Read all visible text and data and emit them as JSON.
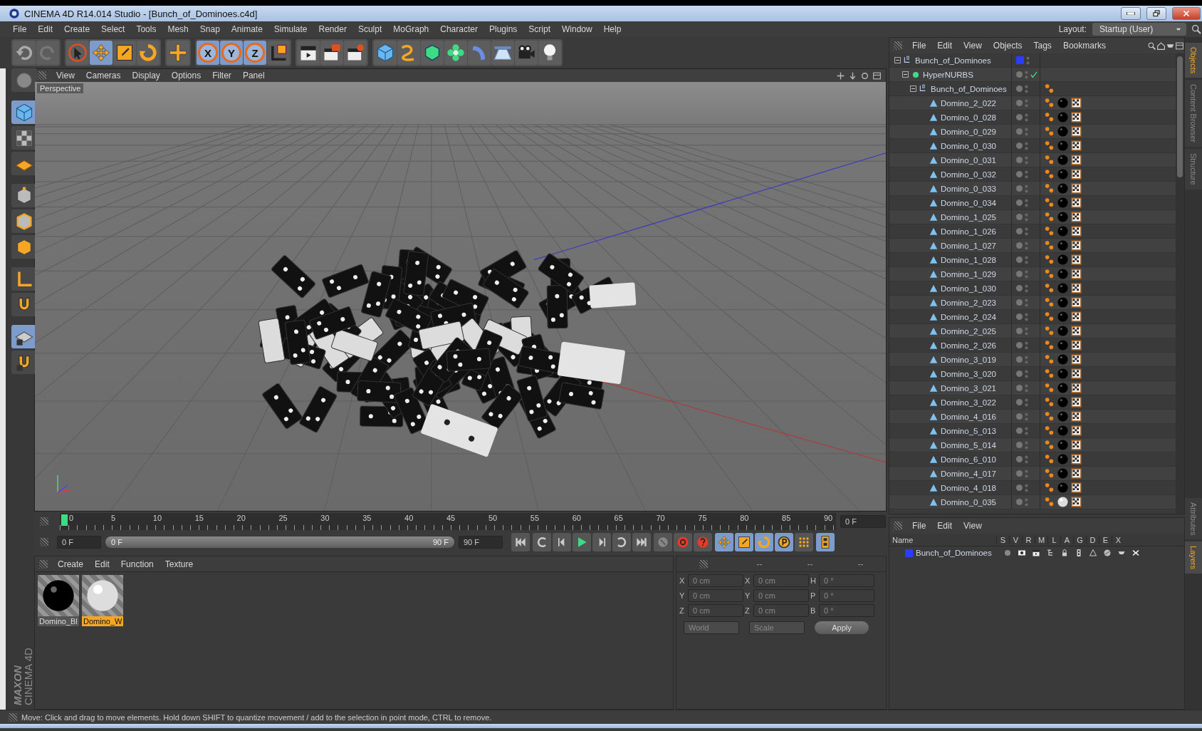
{
  "window": {
    "title": "CINEMA 4D R14.014 Studio - [Bunch_of_Dominoes.c4d]"
  },
  "menu": [
    "File",
    "Edit",
    "Create",
    "Select",
    "Tools",
    "Mesh",
    "Snap",
    "Animate",
    "Simulate",
    "Render",
    "Sculpt",
    "MoGraph",
    "Character",
    "Plugins",
    "Script",
    "Window",
    "Help"
  ],
  "layout": {
    "label": "Layout:",
    "value": "Startup (User)"
  },
  "toolbar": [
    [
      {
        "kind": "undo",
        "selected": false
      },
      {
        "kind": "redo",
        "selected": false
      }
    ],
    [
      {
        "kind": "cursor",
        "selected": false
      },
      {
        "kind": "move",
        "selected": true
      },
      {
        "kind": "scale",
        "selected": false
      },
      {
        "kind": "rotate",
        "selected": false
      }
    ],
    [
      {
        "kind": "cross",
        "selected": false
      }
    ],
    [
      {
        "kind": "axis",
        "label": "X",
        "selected": true
      },
      {
        "kind": "axis",
        "label": "Y",
        "selected": true
      },
      {
        "kind": "axis",
        "label": "Z",
        "selected": true
      },
      {
        "kind": "coord",
        "selected": false
      }
    ],
    [
      {
        "kind": "clapper",
        "selected": false
      },
      {
        "kind": "clapper-view",
        "selected": false
      },
      {
        "kind": "clapper-gear",
        "selected": false
      }
    ],
    [
      {
        "kind": "cube",
        "selected": false
      },
      {
        "kind": "spline",
        "selected": false
      },
      {
        "kind": "nurbs-cube",
        "selected": false
      },
      {
        "kind": "flower",
        "selected": false
      },
      {
        "kind": "bend",
        "selected": false
      },
      {
        "kind": "plane",
        "selected": false
      },
      {
        "kind": "camera",
        "selected": false
      },
      {
        "kind": "bulb",
        "selected": false
      }
    ]
  ],
  "tool_palette": [
    {
      "kind": "sphere",
      "selected": false
    },
    {
      "kind": "cube",
      "selected": true
    },
    {
      "kind": "checker",
      "selected": false
    },
    {
      "kind": "grid",
      "selected": false
    },
    {
      "kind": "points",
      "selected": false
    },
    {
      "kind": "edges",
      "selected": false
    },
    {
      "kind": "polygons",
      "selected": false
    },
    {
      "kind": "corner",
      "selected": false
    },
    {
      "kind": "magnet",
      "selected": false
    },
    {
      "kind": "grid-lock",
      "selected": true
    },
    {
      "kind": "magnet-lock",
      "selected": false
    }
  ],
  "logo": {
    "brand": "MAXON",
    "product": "CINEMA 4D"
  },
  "viewport": {
    "menu": [
      "View",
      "Cameras",
      "Display",
      "Options",
      "Filter",
      "Panel"
    ],
    "label": "Perspective"
  },
  "timeline": {
    "ticks": [
      "0",
      "5",
      "10",
      "15",
      "20",
      "25",
      "30",
      "35",
      "40",
      "45",
      "50",
      "55",
      "60",
      "65",
      "70",
      "75",
      "80",
      "85",
      "90"
    ],
    "level": 0,
    "frame": "0 F"
  },
  "transport": {
    "start": "0 F",
    "range": {
      "start": "0 F",
      "end": "90 F",
      "level": 1
    },
    "end": "90 F",
    "buttons": [
      {
        "kind": "to-start",
        "selected": false
      },
      {
        "kind": "loop-back",
        "selected": false
      },
      {
        "kind": "step-back",
        "selected": false
      },
      {
        "kind": "play",
        "selected": false
      },
      {
        "kind": "step-forward",
        "selected": false
      },
      {
        "kind": "loop",
        "selected": false
      },
      {
        "kind": "to-end",
        "selected": false
      },
      {
        "kind": "key-lock",
        "selected": false
      },
      {
        "kind": "record",
        "selected": false
      },
      {
        "kind": "help",
        "selected": false
      },
      {
        "kind": "move",
        "selected": true
      },
      {
        "kind": "scale",
        "selected": true
      },
      {
        "kind": "rotate",
        "selected": true
      },
      {
        "kind": "param",
        "selected": true
      },
      {
        "kind": "dots",
        "selected": false
      },
      {
        "kind": "film",
        "selected": true
      }
    ]
  },
  "material_manager": {
    "menu": [
      "Create",
      "Edit",
      "Function",
      "Texture"
    ],
    "materials": [
      {
        "name": "Domino_Bl",
        "kind": "black",
        "selected": false
      },
      {
        "name": "Domino_W",
        "kind": "white",
        "selected": true
      }
    ]
  },
  "coordinates": {
    "disabled": true,
    "headers": [
      "--",
      "--",
      "--"
    ],
    "rows": [
      [
        {
          "axis": "X",
          "value": "0 cm"
        },
        {
          "axis": "X",
          "value": "0 cm"
        },
        {
          "axis": "H",
          "value": "0 °"
        }
      ],
      [
        {
          "axis": "Y",
          "value": "0 cm"
        },
        {
          "axis": "Y",
          "value": "0 cm"
        },
        {
          "axis": "P",
          "value": "0 °"
        }
      ],
      [
        {
          "axis": "Z",
          "value": "0 cm"
        },
        {
          "axis": "Z",
          "value": "0 cm"
        },
        {
          "axis": "B",
          "value": "0 °"
        }
      ]
    ],
    "dropdowns": [
      "World",
      "Scale"
    ],
    "apply": "Apply"
  },
  "object_manager": {
    "menu": [
      "File",
      "Edit",
      "View",
      "Objects",
      "Tags",
      "Bookmarks"
    ],
    "tree": [
      {
        "name": "Bunch_of_Dominoes",
        "kind": "null",
        "color": "#2a3cff",
        "expanded": true,
        "children": [
          {
            "name": "HyperNURBS",
            "kind": "nurbs",
            "enabled": true,
            "expanded": true,
            "children": [
              {
                "name": "Bunch_of_Dominoes",
                "kind": "null",
                "expanded": true,
                "tags": [
                  {
                    "kind": "phong"
                  }
                ],
                "children": [
                  {
                    "name": "Domino_2_022",
                    "kind": "polygon",
                    "tags": [
                      {
                        "kind": "phong"
                      },
                      {
                        "kind": "black-material"
                      },
                      {
                        "kind": "texture"
                      }
                    ]
                  },
                  {
                    "name": "Domino_0_028",
                    "kind": "polygon",
                    "tags": [
                      {
                        "kind": "phong"
                      },
                      {
                        "kind": "black-material"
                      },
                      {
                        "kind": "texture"
                      }
                    ]
                  },
                  {
                    "name": "Domino_0_029",
                    "kind": "polygon",
                    "tags": [
                      {
                        "kind": "phong"
                      },
                      {
                        "kind": "black-material"
                      },
                      {
                        "kind": "texture"
                      }
                    ]
                  },
                  {
                    "name": "Domino_0_030",
                    "kind": "polygon",
                    "tags": [
                      {
                        "kind": "phong"
                      },
                      {
                        "kind": "black-material"
                      },
                      {
                        "kind": "texture"
                      }
                    ]
                  },
                  {
                    "name": "Domino_0_031",
                    "kind": "polygon",
                    "tags": [
                      {
                        "kind": "phong"
                      },
                      {
                        "kind": "black-material"
                      },
                      {
                        "kind": "texture"
                      }
                    ]
                  },
                  {
                    "name": "Domino_0_032",
                    "kind": "polygon",
                    "tags": [
                      {
                        "kind": "phong"
                      },
                      {
                        "kind": "black-material"
                      },
                      {
                        "kind": "texture"
                      }
                    ]
                  },
                  {
                    "name": "Domino_0_033",
                    "kind": "polygon",
                    "tags": [
                      {
                        "kind": "phong"
                      },
                      {
                        "kind": "black-material"
                      },
                      {
                        "kind": "texture"
                      }
                    ]
                  },
                  {
                    "name": "Domino_0_034",
                    "kind": "polygon",
                    "tags": [
                      {
                        "kind": "phong"
                      },
                      {
                        "kind": "black-material"
                      },
                      {
                        "kind": "texture"
                      }
                    ]
                  },
                  {
                    "name": "Domino_1_025",
                    "kind": "polygon",
                    "tags": [
                      {
                        "kind": "phong"
                      },
                      {
                        "kind": "black-material"
                      },
                      {
                        "kind": "texture"
                      }
                    ]
                  },
                  {
                    "name": "Domino_1_026",
                    "kind": "polygon",
                    "tags": [
                      {
                        "kind": "phong"
                      },
                      {
                        "kind": "black-material"
                      },
                      {
                        "kind": "texture"
                      }
                    ]
                  },
                  {
                    "name": "Domino_1_027",
                    "kind": "polygon",
                    "tags": [
                      {
                        "kind": "phong"
                      },
                      {
                        "kind": "black-material"
                      },
                      {
                        "kind": "texture"
                      }
                    ]
                  },
                  {
                    "name": "Domino_1_028",
                    "kind": "polygon",
                    "tags": [
                      {
                        "kind": "phong"
                      },
                      {
                        "kind": "black-material"
                      },
                      {
                        "kind": "texture"
                      }
                    ]
                  },
                  {
                    "name": "Domino_1_029",
                    "kind": "polygon",
                    "tags": [
                      {
                        "kind": "phong"
                      },
                      {
                        "kind": "black-material"
                      },
                      {
                        "kind": "texture"
                      }
                    ]
                  },
                  {
                    "name": "Domino_1_030",
                    "kind": "polygon",
                    "tags": [
                      {
                        "kind": "phong"
                      },
                      {
                        "kind": "black-material"
                      },
                      {
                        "kind": "texture"
                      }
                    ]
                  },
                  {
                    "name": "Domino_2_023",
                    "kind": "polygon",
                    "tags": [
                      {
                        "kind": "phong"
                      },
                      {
                        "kind": "black-material"
                      },
                      {
                        "kind": "texture"
                      }
                    ]
                  },
                  {
                    "name": "Domino_2_024",
                    "kind": "polygon",
                    "tags": [
                      {
                        "kind": "phong"
                      },
                      {
                        "kind": "black-material"
                      },
                      {
                        "kind": "texture"
                      }
                    ]
                  },
                  {
                    "name": "Domino_2_025",
                    "kind": "polygon",
                    "tags": [
                      {
                        "kind": "phong"
                      },
                      {
                        "kind": "black-material"
                      },
                      {
                        "kind": "texture"
                      }
                    ]
                  },
                  {
                    "name": "Domino_2_026",
                    "kind": "polygon",
                    "tags": [
                      {
                        "kind": "phong"
                      },
                      {
                        "kind": "black-material"
                      },
                      {
                        "kind": "texture"
                      }
                    ]
                  },
                  {
                    "name": "Domino_3_019",
                    "kind": "polygon",
                    "tags": [
                      {
                        "kind": "phong"
                      },
                      {
                        "kind": "black-material"
                      },
                      {
                        "kind": "texture"
                      }
                    ]
                  },
                  {
                    "name": "Domino_3_020",
                    "kind": "polygon",
                    "tags": [
                      {
                        "kind": "phong"
                      },
                      {
                        "kind": "black-material"
                      },
                      {
                        "kind": "texture"
                      }
                    ]
                  },
                  {
                    "name": "Domino_3_021",
                    "kind": "polygon",
                    "tags": [
                      {
                        "kind": "phong"
                      },
                      {
                        "kind": "black-material"
                      },
                      {
                        "kind": "texture"
                      }
                    ]
                  },
                  {
                    "name": "Domino_3_022",
                    "kind": "polygon",
                    "tags": [
                      {
                        "kind": "phong"
                      },
                      {
                        "kind": "black-material"
                      },
                      {
                        "kind": "texture"
                      }
                    ]
                  },
                  {
                    "name": "Domino_4_016",
                    "kind": "polygon",
                    "tags": [
                      {
                        "kind": "phong"
                      },
                      {
                        "kind": "black-material"
                      },
                      {
                        "kind": "texture"
                      }
                    ]
                  },
                  {
                    "name": "Domino_5_013",
                    "kind": "polygon",
                    "tags": [
                      {
                        "kind": "phong"
                      },
                      {
                        "kind": "black-material"
                      },
                      {
                        "kind": "texture"
                      }
                    ]
                  },
                  {
                    "name": "Domino_5_014",
                    "kind": "polygon",
                    "tags": [
                      {
                        "kind": "phong"
                      },
                      {
                        "kind": "black-material"
                      },
                      {
                        "kind": "texture"
                      }
                    ]
                  },
                  {
                    "name": "Domino_6_010",
                    "kind": "polygon",
                    "tags": [
                      {
                        "kind": "phong"
                      },
                      {
                        "kind": "black-material"
                      },
                      {
                        "kind": "texture"
                      }
                    ]
                  },
                  {
                    "name": "Domino_4_017",
                    "kind": "polygon",
                    "tags": [
                      {
                        "kind": "phong"
                      },
                      {
                        "kind": "black-material"
                      },
                      {
                        "kind": "texture"
                      }
                    ]
                  },
                  {
                    "name": "Domino_4_018",
                    "kind": "polygon",
                    "tags": [
                      {
                        "kind": "phong"
                      },
                      {
                        "kind": "black-material"
                      },
                      {
                        "kind": "texture"
                      }
                    ]
                  },
                  {
                    "name": "Domino_0_035",
                    "kind": "polygon",
                    "tags": [
                      {
                        "kind": "phong"
                      },
                      {
                        "kind": "white-material"
                      },
                      {
                        "kind": "texture"
                      }
                    ]
                  }
                ]
              }
            ]
          }
        ]
      }
    ]
  },
  "layer_manager": {
    "menu": [
      "File",
      "Edit",
      "View"
    ],
    "columns": [
      "Name",
      "S",
      "V",
      "R",
      "M",
      "L",
      "A",
      "G",
      "D",
      "E",
      "X"
    ],
    "layers": [
      {
        "name": "Bunch_of_Dominoes",
        "color": "#2a3cff"
      }
    ]
  },
  "side_tabs_top": [
    {
      "label": "Objects",
      "selected": true
    },
    {
      "label": "Content Browser",
      "selected": false
    },
    {
      "label": "Structure",
      "selected": false
    }
  ],
  "side_tabs_bottom": [
    {
      "label": "Attributes",
      "selected": false
    },
    {
      "label": "Layers",
      "selected": true
    }
  ],
  "status_bar": "Move: Click and drag to move elements. Hold down SHIFT to quantize movement / add to the selection in point mode, CTRL to remove."
}
